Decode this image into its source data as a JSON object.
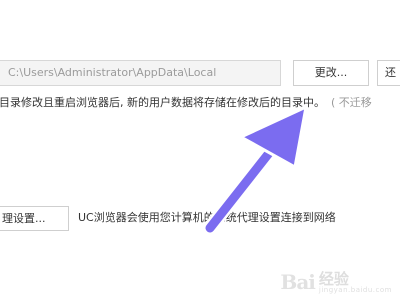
{
  "storage": {
    "path_value": "C:\\Users\\Administrator\\AppData\\Local",
    "change_button_label": "更改...",
    "partial_button_label": "还",
    "note_text": "目录修改且重启浏览器后, 新的用户数据将存储在修改后的目录中。",
    "note_hint": "( 不迁移"
  },
  "proxy": {
    "settings_button_label": "理设置...",
    "description": "UC浏览器会使用您计算机的系统代理设置连接到网络"
  },
  "annotation": {
    "arrow_color": "#7b6cf0",
    "arrow_outline": "#ffffff"
  },
  "watermark": {
    "logo": "Bai",
    "text_cn": "经验",
    "url": "jingyan.baidu.com"
  }
}
